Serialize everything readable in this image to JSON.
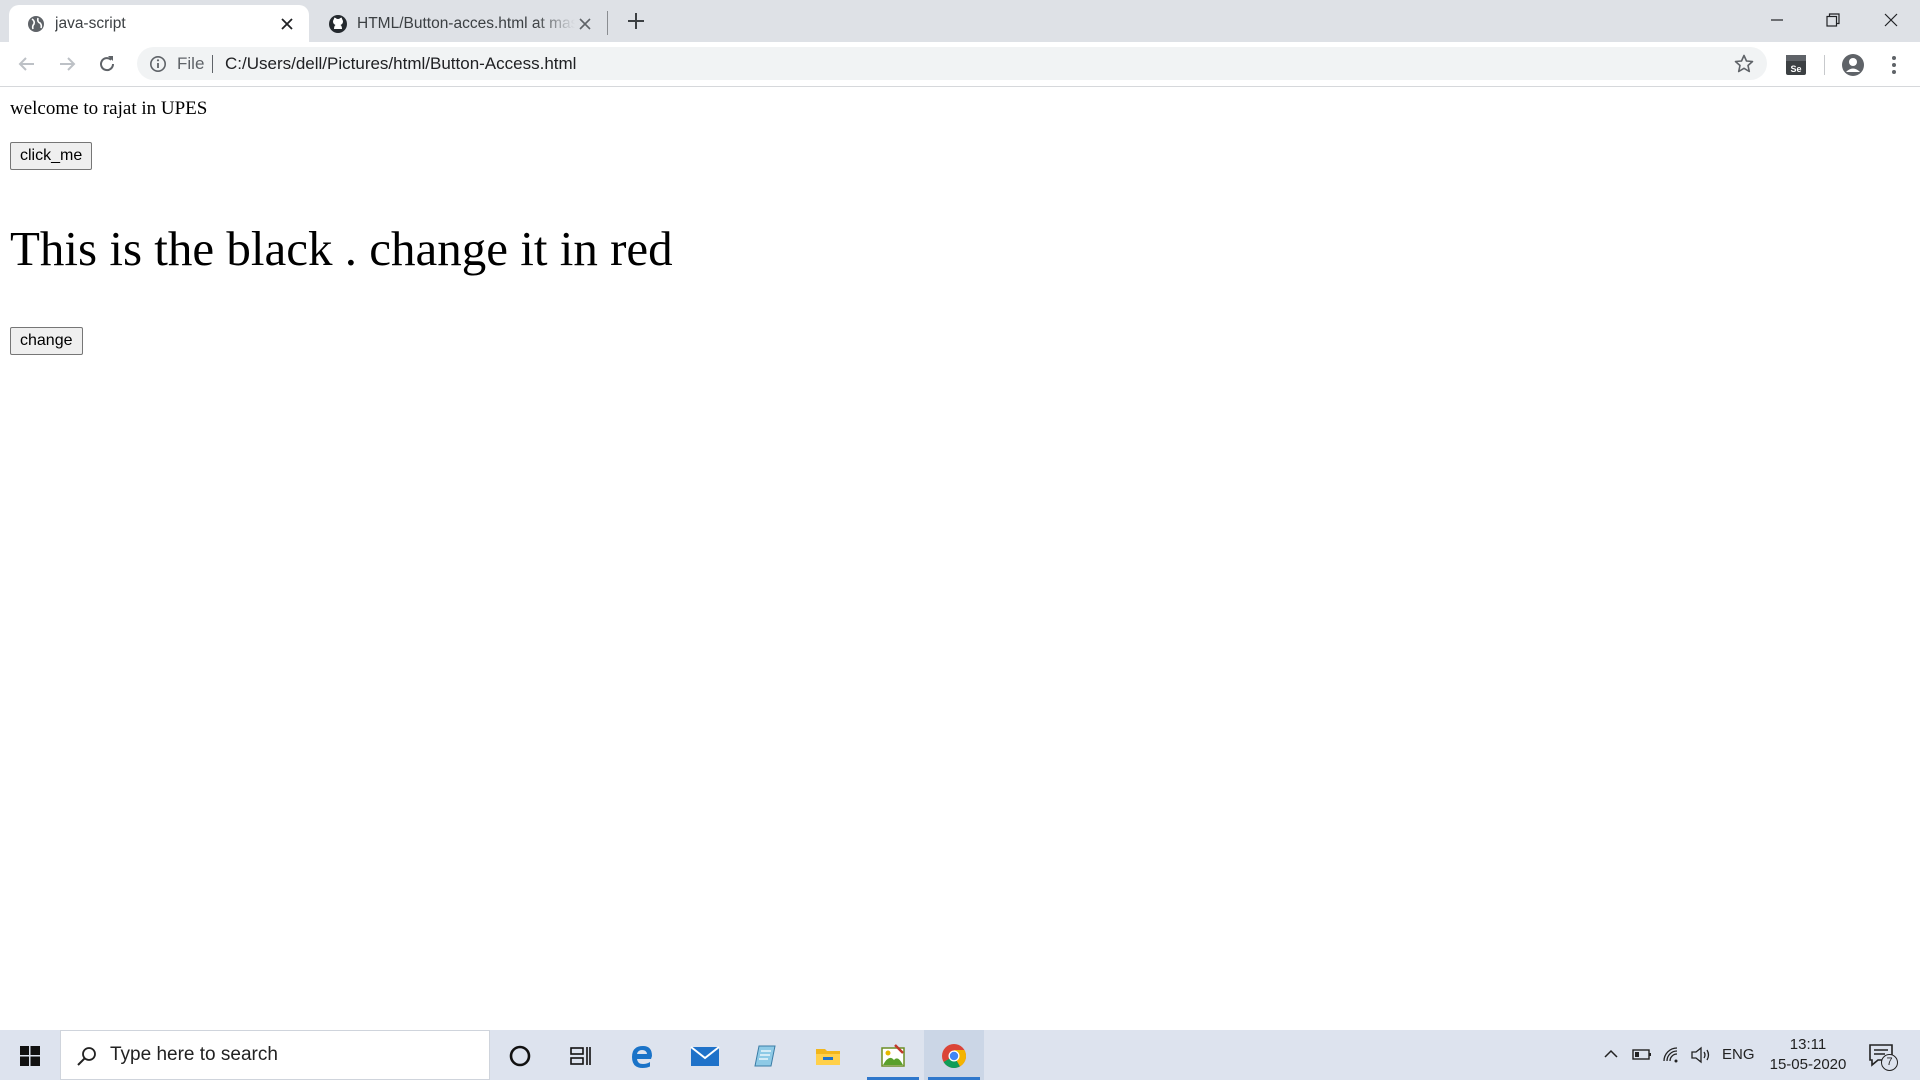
{
  "browser": {
    "tabs": [
      {
        "title": "java-script",
        "active": true,
        "icon": "globe-icon"
      },
      {
        "title": "HTML/Button-acces.html at master",
        "active": false,
        "icon": "github-icon"
      }
    ],
    "address_bar": {
      "chip_label": "File",
      "url": "C:/Users/dell/Pictures/html/Button-Access.html"
    }
  },
  "page": {
    "welcome_text": "welcome to rajat in UPES",
    "click_button_label": "click_me",
    "headline": "This is the black . change it in red",
    "change_button_label": "change"
  },
  "taskbar": {
    "search_placeholder": "Type here to search",
    "apps": [
      "cortana-icon",
      "task-view-icon",
      "edge-icon",
      "mail-icon",
      "notepad-icon",
      "file-explorer-icon",
      "paint-icon",
      "chrome-icon"
    ],
    "language": "ENG",
    "time": "13:11",
    "date": "15-05-2020",
    "notification_count": "7"
  },
  "colors": {
    "tabstrip_bg": "#dee1e6",
    "omnibox_bg": "#f1f3f4",
    "taskbar_bg": "#dde3ee",
    "running_indicator": "#2f78cc"
  }
}
